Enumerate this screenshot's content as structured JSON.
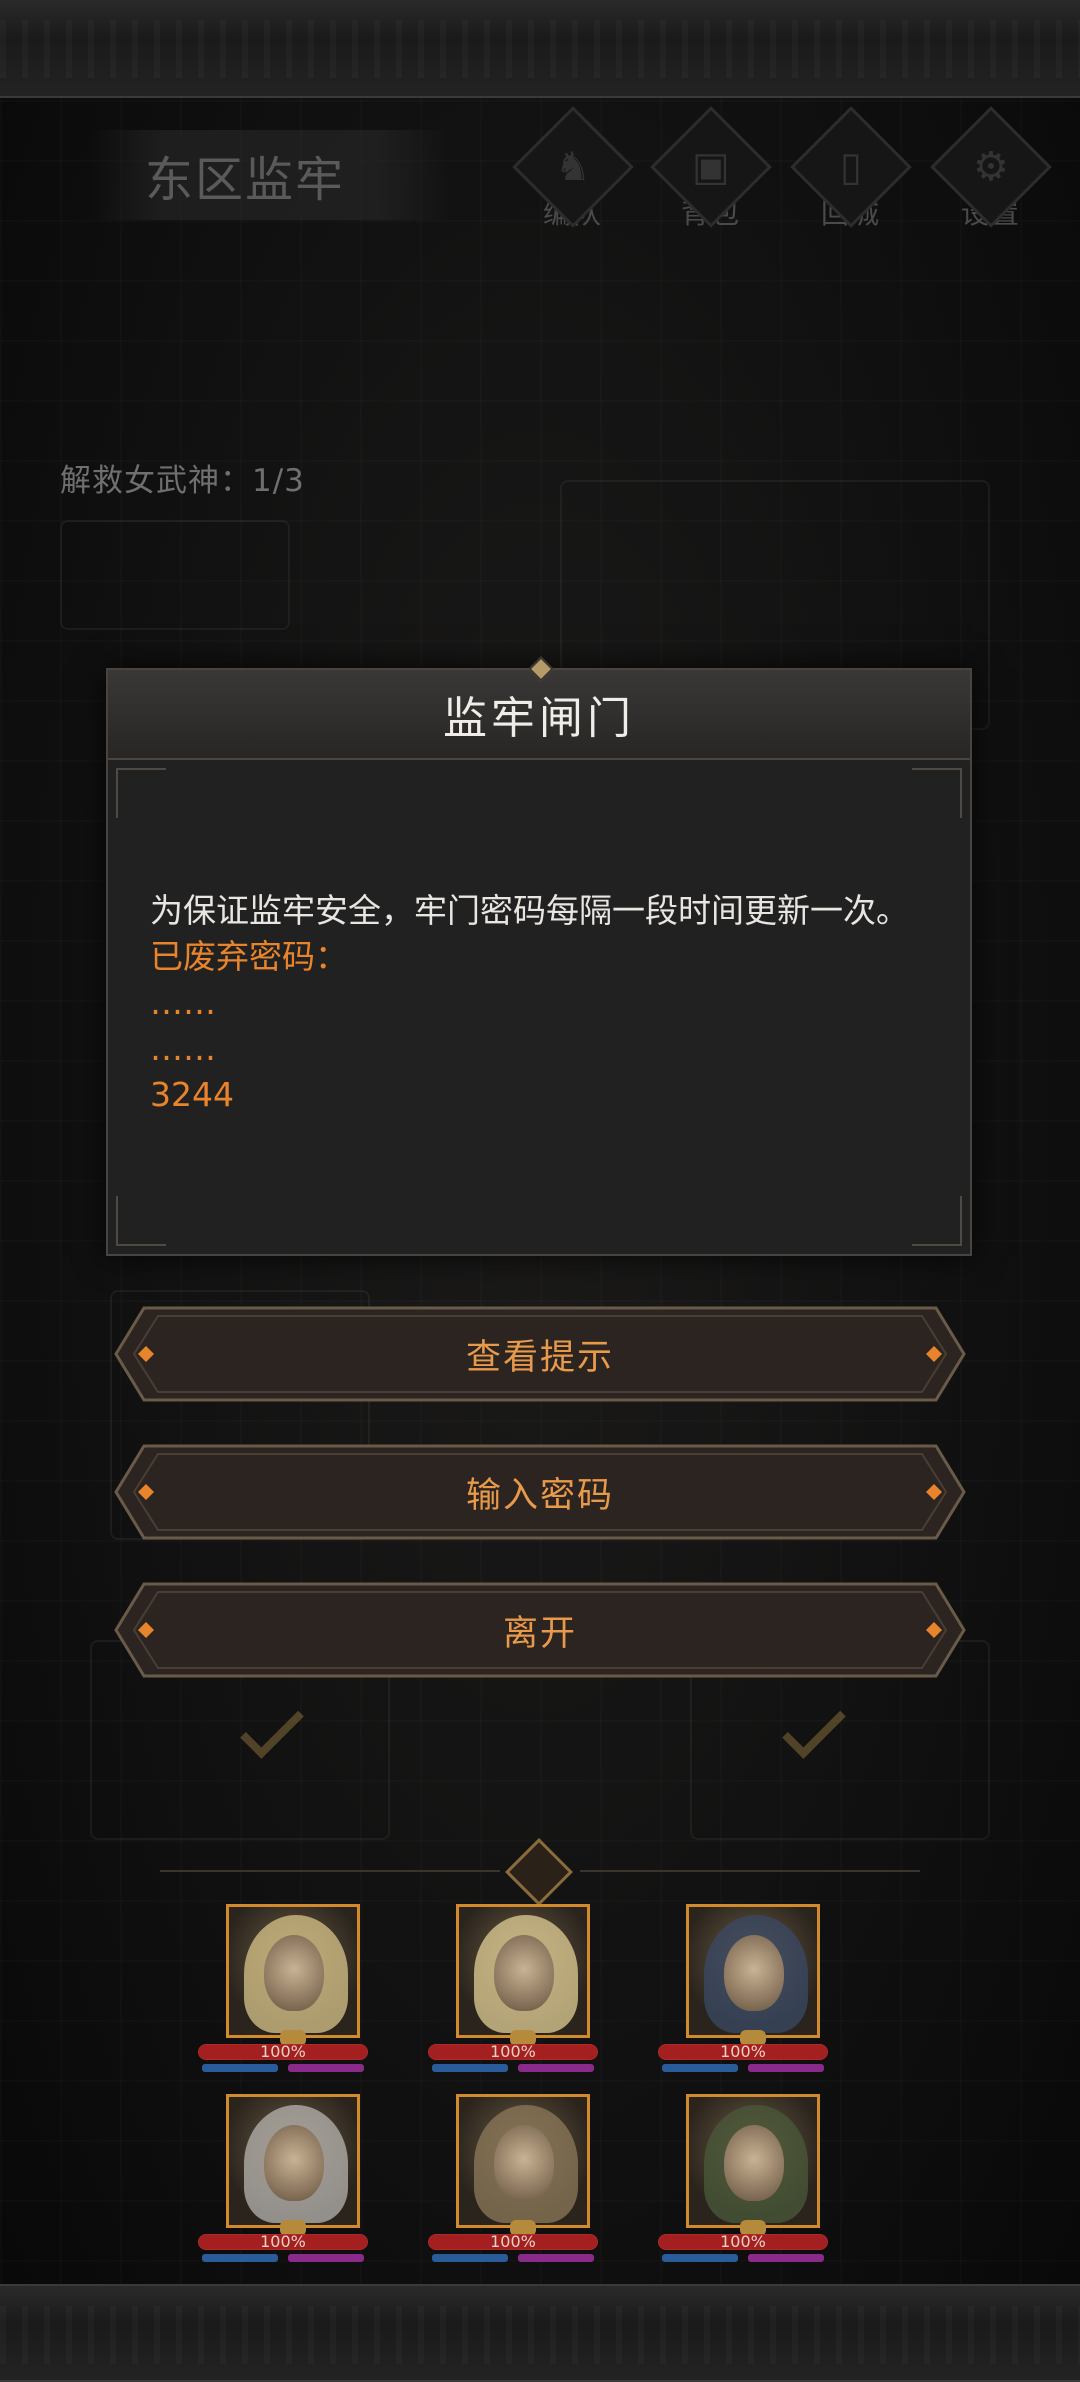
{
  "location": {
    "name": "东区监牢"
  },
  "hud": [
    {
      "id": "team",
      "label": "编队",
      "icon": "helmet-icon"
    },
    {
      "id": "bag",
      "label": "背包",
      "icon": "bag-icon"
    },
    {
      "id": "town",
      "label": "回城",
      "icon": "door-icon"
    },
    {
      "id": "settings",
      "label": "设置",
      "icon": "gear-icon"
    }
  ],
  "quest": {
    "text": "解救女武神：1/3"
  },
  "dialog": {
    "title": "监牢闸门",
    "message": "为保证监牢安全，牢门密码每隔一段时间更新一次。",
    "discarded_label": "已废弃密码：",
    "codes": [
      "……",
      "……",
      "3244"
    ]
  },
  "actions": [
    {
      "id": "hint",
      "label": "查看提示"
    },
    {
      "id": "enter",
      "label": "输入密码"
    },
    {
      "id": "leave",
      "label": "离开"
    }
  ],
  "heroes": [
    {
      "hp_percent": 100,
      "hp_text": "100%",
      "hair": "#d8c48a"
    },
    {
      "hp_percent": 100,
      "hp_text": "100%",
      "hair": "#e2cf96"
    },
    {
      "hp_percent": 100,
      "hp_text": "100%",
      "hair": "#3a4a66"
    },
    {
      "hp_percent": 100,
      "hp_text": "100%",
      "hair": "#b7b4b0"
    },
    {
      "hp_percent": 100,
      "hp_text": "100%",
      "hair": "#8c7a5a"
    },
    {
      "hp_percent": 100,
      "hp_text": "100%",
      "hair": "#4a5a3a"
    }
  ],
  "colors": {
    "accent_orange": "#e8842c",
    "button_text": "#e89a4a",
    "portrait_border": "#d18a2e"
  }
}
